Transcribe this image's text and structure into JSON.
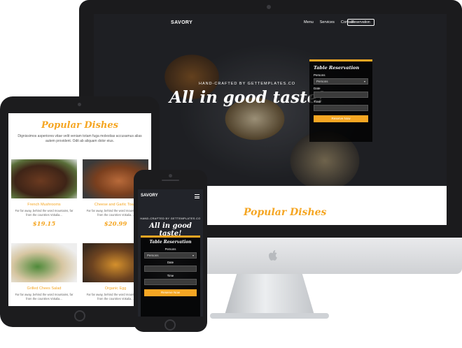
{
  "monitor": {
    "brand": "SAVORY",
    "nav": [
      "Menu",
      "Services",
      "Contact"
    ],
    "cta": "Reservation",
    "tagline": "HAND-CRAFTED BY GETTEMPLATES.CO",
    "headline": "All in good taste!",
    "reservation": {
      "title": "Table Reservation",
      "persons_label": "Persons",
      "persons_value": "Persons",
      "date_label": "Date",
      "time_label": "Time",
      "button": "Reserve Now"
    },
    "section_title": "Popular Dishes"
  },
  "tablet": {
    "title": "Popular Dishes",
    "intro": "Dignissimos asperiores vitae velit veniam totam fuga molestias accusamus alias autem provident. Odit ab aliquam dolor eius.",
    "dishes": [
      {
        "name": "French Mushrooms",
        "desc": "Far far away, behind the word mountains, far from the countries Vokalia...",
        "price": "$19.15"
      },
      {
        "name": "Cheese and Garlic Toast",
        "desc": "Far far away, behind the word mountains, far from the countries Vokalia...",
        "price": "$20.99"
      },
      {
        "name": "Grilled Chees Salad",
        "desc": "Far far away, behind the word mountains, far from the countries Vokalia...",
        "price": ""
      },
      {
        "name": "Organic Egg",
        "desc": "Far far away, behind the word mountains, far from the countries Vokalia...",
        "price": ""
      }
    ]
  },
  "phone": {
    "brand": "SAVORY",
    "tagline": "HAND-CRAFTED BY GETTEMPLATES.CO",
    "headline": "All in good taste!",
    "reservation": {
      "title": "Table Reservation",
      "persons_label": "Persons",
      "persons_value": "Persons",
      "date_label": "Date",
      "time_label": "Time",
      "button": "Reserve Now"
    }
  },
  "colors": {
    "accent": "#f5a623",
    "device": "#1c1c1e"
  }
}
